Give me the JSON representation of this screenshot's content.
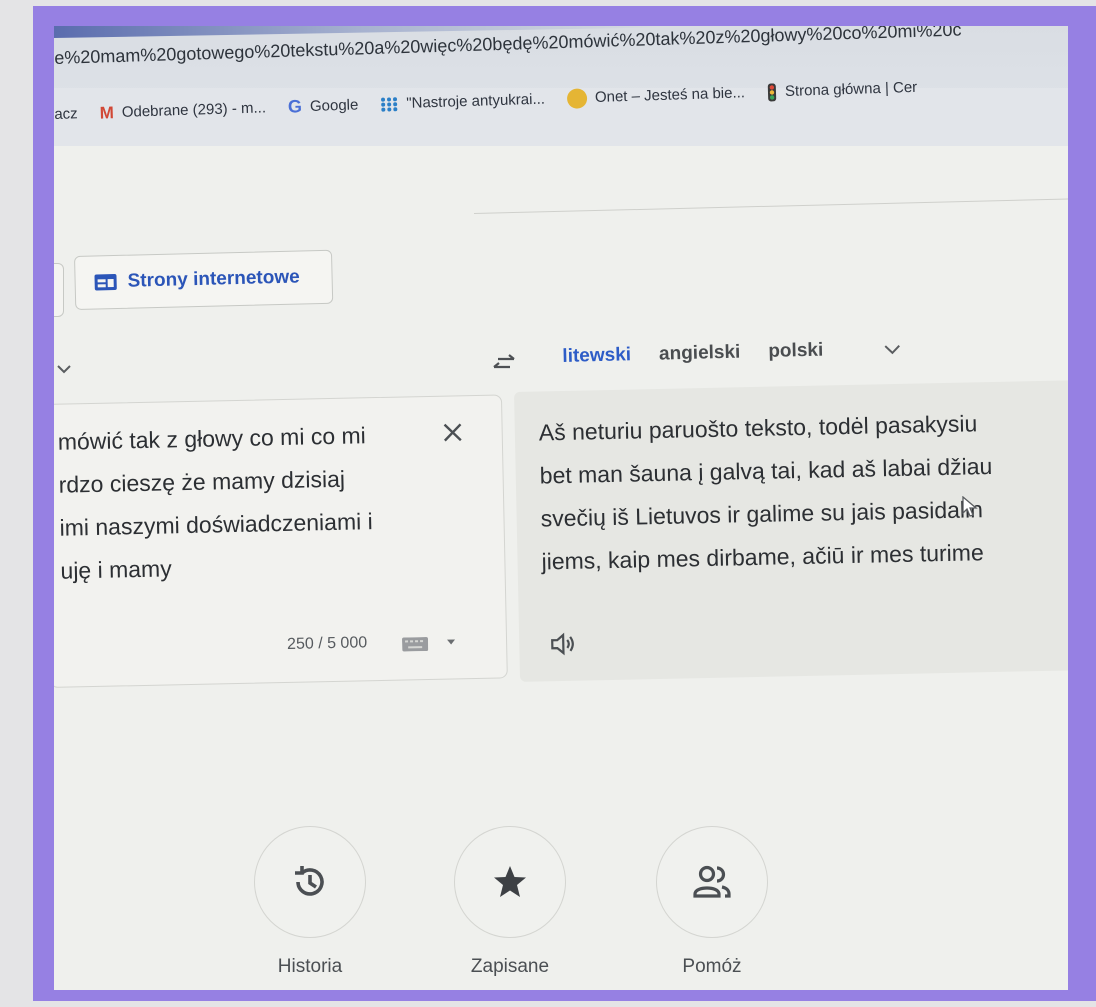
{
  "browser": {
    "url": "e%20mam%20gotowego%20tekstu%20a%20więc%20będę%20mówić%20tak%20z%20głowy%20co%20mi%20c",
    "bookmarks": [
      {
        "label": "acz",
        "icon": "none"
      },
      {
        "label": "Odebrane (293) - m...",
        "icon": "gmail-icon"
      },
      {
        "label": "Google",
        "icon": "google-icon"
      },
      {
        "label": "\"Nastroje antyukrai...",
        "icon": "grid-dots-icon"
      },
      {
        "label": "Onet – Jesteś na bie...",
        "icon": "onet-icon"
      },
      {
        "label": "Strona główna | Cer",
        "icon": "traffic-light-icon"
      }
    ]
  },
  "translate": {
    "websites_button": "Strony internetowe",
    "target_languages": [
      "litewski",
      "angielski",
      "polski"
    ],
    "active_target": "litewski",
    "source_lines": [
      "mówić tak z głowy co mi co mi",
      "rdzo cieszę że mamy dzisiaj",
      "imi naszymi doświadczeniami i",
      "uję i mamy"
    ],
    "char_count": "250 / 5 000",
    "target_lines": [
      "Aš neturiu paruošto teksto, todėl pasakysiu",
      "bet man šauna į galvą tai, kad aš labai džiau",
      "svečių iš Lietuvos ir galime su jais pasidalin",
      "jiems, kaip mes dirbame, ačiū ir mes turime"
    ]
  },
  "actions": {
    "history": "Historia",
    "saved": "Zapisane",
    "contribute": "Pomóż"
  },
  "colors": {
    "accent": "#2d5cc7",
    "frame": "#9680e3"
  }
}
